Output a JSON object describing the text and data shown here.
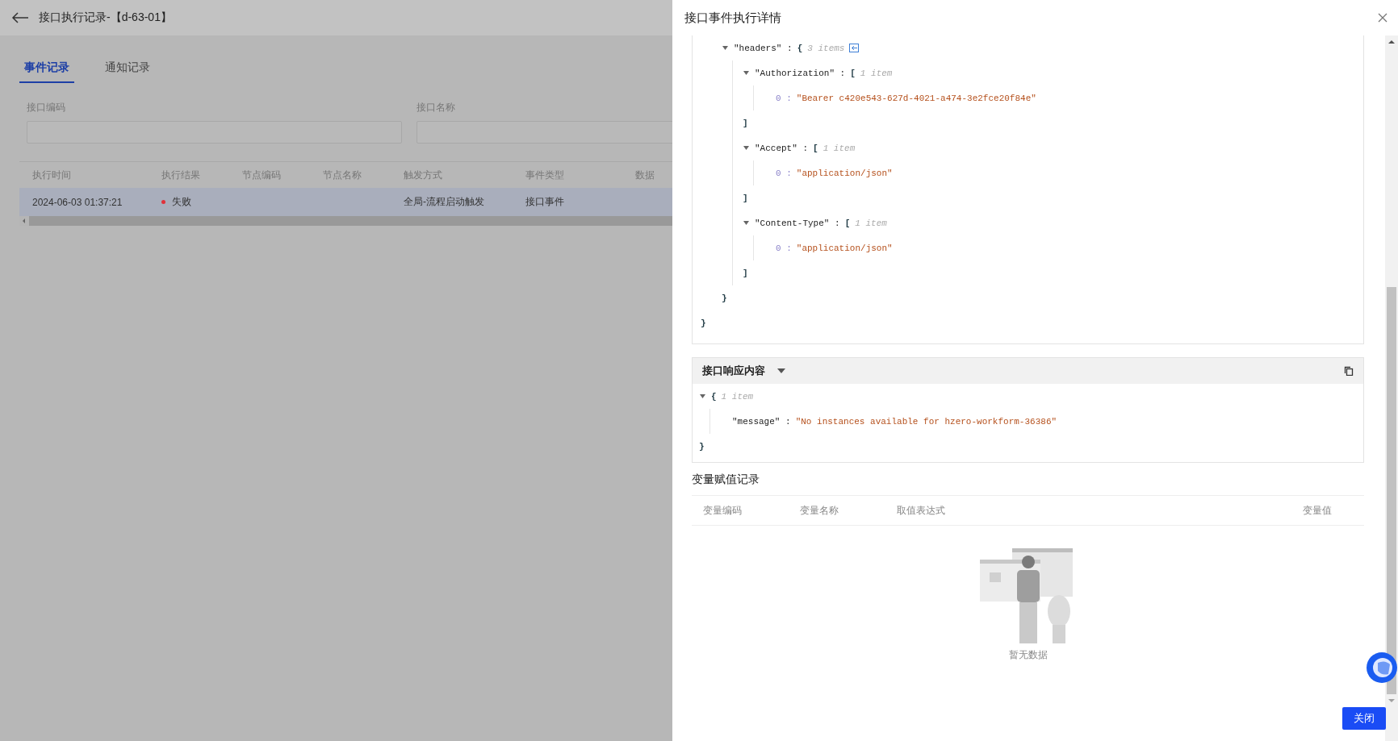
{
  "page": {
    "title": "接口执行记录-【d-63-01】",
    "tabs": [
      {
        "label": "事件记录",
        "selected": true
      },
      {
        "label": "通知记录",
        "selected": false
      }
    ],
    "filters": [
      {
        "label": "接口编码"
      },
      {
        "label": "接口名称"
      }
    ],
    "table": {
      "columns": [
        "执行时间",
        "执行结果",
        "节点编码",
        "节点名称",
        "触发方式",
        "事件类型",
        "数据"
      ],
      "rows": [
        {
          "time": "2024-06-03 01:37:21",
          "result": "失败",
          "color": "#e0313a",
          "trigger": "全局-流程启动触发",
          "event_type": "接口事件",
          "selected": true
        }
      ]
    }
  },
  "drawer": {
    "title": "接口事件执行详情",
    "request": {
      "nodes": [
        {
          "key": "\"headers\" :",
          "bracket": "{",
          "count": "3 items",
          "expanded": true,
          "collapse_icon": true,
          "close": "}",
          "children": [
            {
              "key": "\"Authorization\" :",
              "bracket": "[",
              "count": "1 item",
              "expanded": true,
              "close": "]",
              "children": [
                {
                  "kind": "index",
                  "key": "0 :",
                  "value": "\"Bearer c420e543-627d-4021-a474-3e2fce20f84e\""
                }
              ]
            },
            {
              "key": "\"Accept\" :",
              "bracket": "[",
              "count": "1 item",
              "expanded": true,
              "close": "]",
              "children": [
                {
                  "kind": "index",
                  "key": "0 :",
                  "value": "\"application/json\""
                }
              ]
            },
            {
              "key": "\"Content-Type\" :",
              "bracket": "[",
              "count": "1 item",
              "expanded": true,
              "close": "]",
              "children": [
                {
                  "kind": "index",
                  "key": "0 :",
                  "value": "\"application/json\""
                }
              ]
            }
          ]
        }
      ],
      "close": "}"
    },
    "response": {
      "title": "接口响应内容",
      "nodes": [
        {
          "bracket": "{",
          "count": "1 item",
          "expanded": true,
          "close": "}",
          "children": [
            {
              "kind": "pair",
              "key": "\"message\" :",
              "value": "\"No instances available for hzero-workform-36386\""
            }
          ]
        }
      ]
    },
    "variables": {
      "title": "变量赋值记录",
      "columns": [
        "变量编码",
        "变量名称",
        "取值表达式",
        "变量值"
      ],
      "empty_text": "暂无数据"
    },
    "buttons": [
      "关闭"
    ]
  }
}
